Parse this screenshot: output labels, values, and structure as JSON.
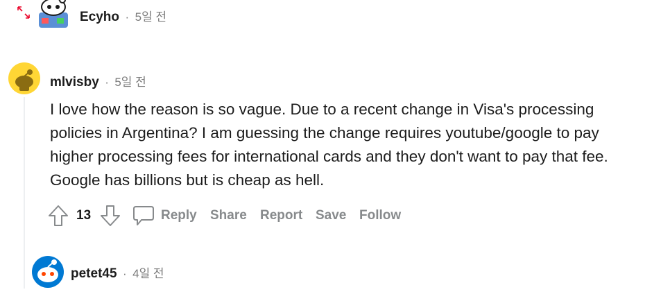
{
  "comments": [
    {
      "author": "Ecyho",
      "time": "5일 전",
      "separator": "·"
    },
    {
      "author": "mlvisby",
      "time": "5일 전",
      "separator": "·",
      "body_lines": [
        "I love how the reason is so vague. Due to a recent change in Visa's processing",
        "policies in Argentina? I am guessing the change requires youtube/google to pay",
        "higher processing fees for international cards and they don't want to pay that fee.",
        "Google has billions but is cheap as hell."
      ],
      "votes": "13",
      "actions": {
        "reply": "Reply",
        "share": "Share",
        "report": "Report",
        "save": "Save",
        "follow": "Follow"
      }
    },
    {
      "author": "petet45",
      "time": "4일 전",
      "separator": "·"
    }
  ],
  "colors": {
    "expand_arrows": "#ea0027",
    "avatar_yellow": "#ffd635",
    "avatar_blue": "#0079d3",
    "muted_text": "#878a8c",
    "thread_line": "#edeff1"
  },
  "icons": [
    "expand-icon",
    "upvote-icon",
    "downvote-icon",
    "reply-bubble-icon"
  ]
}
